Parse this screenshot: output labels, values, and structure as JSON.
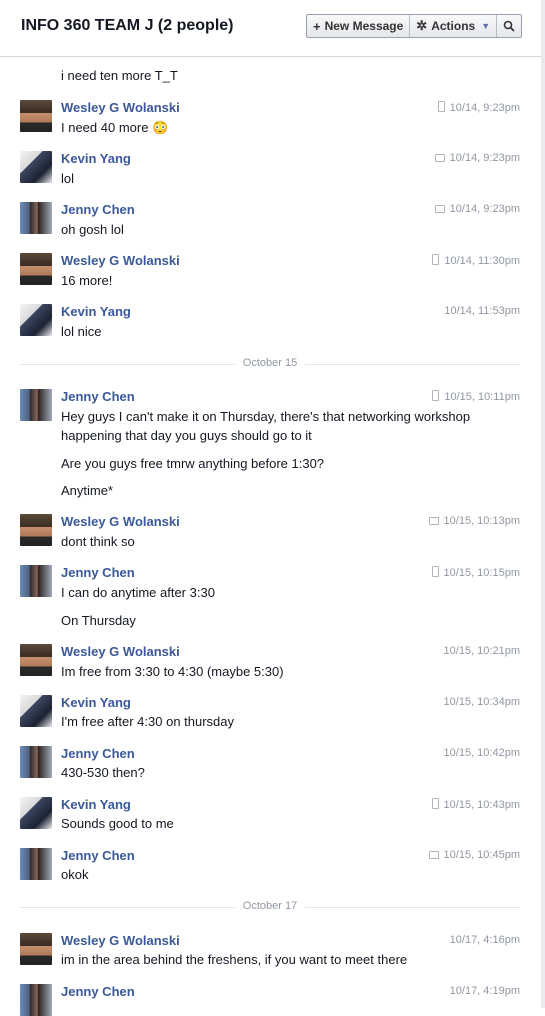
{
  "header": {
    "title": "INFO 360 TEAM J (2 people)",
    "new_message": "New Message",
    "actions": "Actions",
    "icons": {
      "new": "plus-icon",
      "actions": "gear-icon",
      "search": "search-icon"
    }
  },
  "colors": {
    "name": "#3b5998",
    "meta": "#9197a3",
    "divider": "#e5e5e5"
  },
  "partial_top": "i need ten more T_T",
  "messages": [
    {
      "sender": "Wesley G Wolanski",
      "time": "10/14, 9:23pm",
      "lines": [
        "I need 40 more 😳"
      ]
    },
    {
      "sender": "Kevin Yang",
      "time": "10/14, 9:23pm",
      "lines": [
        "lol"
      ]
    },
    {
      "sender": "Jenny Chen",
      "time": "10/14, 9:23pm",
      "lines": [
        "oh gosh lol"
      ]
    },
    {
      "sender": "Wesley G Wolanski",
      "time": "10/14, 11:30pm",
      "lines": [
        "16 more!"
      ]
    },
    {
      "sender": "Kevin Yang",
      "time": "10/14, 11:53pm",
      "lines": [
        "lol nice"
      ]
    },
    {
      "sender": "Jenny Chen",
      "time": "10/15, 10:11pm",
      "lines": [
        "Hey guys I can't make it on Thursday, there's that networking workshop happening that day you guys should go to it",
        "Are you guys free tmrw anything before 1:30?",
        "Anytime*"
      ]
    },
    {
      "sender": "Wesley G Wolanski",
      "time": "10/15, 10:13pm",
      "lines": [
        "dont think so"
      ]
    },
    {
      "sender": "Jenny Chen",
      "time": "10/15, 10:15pm",
      "lines": [
        "I can do anytime after 3:30",
        "On Thursday"
      ]
    },
    {
      "sender": "Wesley G Wolanski",
      "time": "10/15, 10:21pm",
      "lines": [
        "Im free from 3:30 to 4:30 (maybe 5:30)"
      ]
    },
    {
      "sender": "Kevin Yang",
      "time": "10/15, 10:34pm",
      "lines": [
        "I'm free after 4:30 on thursday"
      ]
    },
    {
      "sender": "Jenny Chen",
      "time": "10/15, 10:42pm",
      "lines": [
        "430-530 then?"
      ]
    },
    {
      "sender": "Kevin Yang",
      "time": "10/15, 10:43pm",
      "lines": [
        "Sounds good to me"
      ]
    },
    {
      "sender": "Jenny Chen",
      "time": "10/15, 10:45pm",
      "lines": [
        "okok"
      ]
    },
    {
      "sender": "Wesley G Wolanski",
      "time": "10/17, 4:16pm",
      "lines": [
        "im in the area behind the freshens, if you want to meet there"
      ]
    },
    {
      "sender": "Jenny Chen",
      "time": "10/17, 4:19pm",
      "lines": []
    }
  ],
  "dividers": [
    "October 15",
    "October 17"
  ]
}
